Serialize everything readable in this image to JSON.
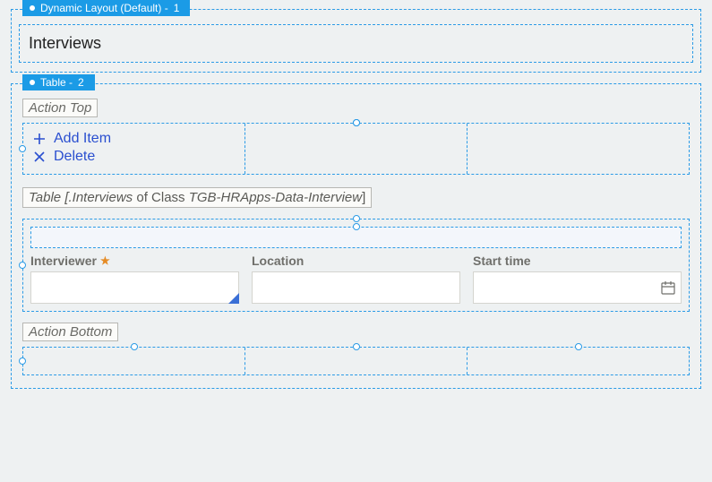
{
  "layout1": {
    "tab_label": "Dynamic Layout (Default) -",
    "tab_index": "1",
    "heading": "Interviews"
  },
  "table_section": {
    "tab_label": "Table -",
    "tab_index": "2",
    "action_top_label": "Action Top",
    "actions": {
      "add_label": "Add Item",
      "delete_label": "Delete"
    },
    "meta": {
      "prefix": "Table [",
      "path": ".Interviews",
      "of": " of Class ",
      "class": "TGB-HRApps-Data-Interview",
      "suffix": "]"
    },
    "columns": {
      "interviewer": {
        "label": "Interviewer",
        "value": ""
      },
      "location": {
        "label": "Location",
        "value": ""
      },
      "start_time": {
        "label": "Start time",
        "value": ""
      }
    },
    "action_bottom_label": "Action Bottom"
  }
}
